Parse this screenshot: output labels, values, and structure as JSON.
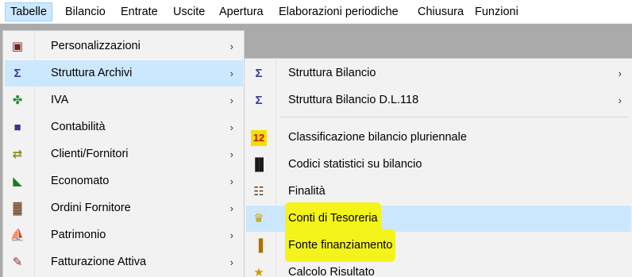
{
  "menubar": {
    "items": [
      "Tabelle",
      "Bilancio",
      "Entrate",
      "Uscite",
      "Apertura",
      "Elaborazioni periodiche",
      "Chiusura",
      "Funzioni"
    ]
  },
  "main_menu": {
    "items": [
      {
        "label": "Personalizzazioni",
        "icon": "personalizzazioni-icon",
        "glyph": "▣",
        "color": "#7a1f1f",
        "submenu": true
      },
      {
        "label": "Struttura Archivi",
        "icon": "struttura-archivi-icon",
        "glyph": "Σ",
        "color": "#3a3a9a",
        "submenu": true
      },
      {
        "label": "IVA",
        "icon": "iva-icon",
        "glyph": "✤",
        "color": "#2a8a3a",
        "submenu": true
      },
      {
        "label": "Contabilità",
        "icon": "contabilita-icon",
        "glyph": "■",
        "color": "#4a2a9a",
        "submenu": true
      },
      {
        "label": "Clienti/Fornitori",
        "icon": "clienti-fornitori-icon",
        "glyph": "⇄",
        "color": "#8a8a1a",
        "submenu": true
      },
      {
        "label": "Economato",
        "icon": "economato-icon",
        "glyph": "◣",
        "color": "#1a7a1a",
        "submenu": true
      },
      {
        "label": "Ordini Fornitore",
        "icon": "ordini-fornitore-icon",
        "glyph": "▓",
        "color": "#6a3a1a",
        "submenu": true
      },
      {
        "label": "Patrimonio",
        "icon": "patrimonio-icon",
        "glyph": "⛵",
        "color": "#333333",
        "submenu": true
      },
      {
        "label": "Fatturazione Attiva",
        "icon": "fatturazione-attiva-icon",
        "glyph": "✎",
        "color": "#8a2a2a",
        "submenu": true
      }
    ]
  },
  "sub_menu": {
    "items": [
      {
        "label": "Struttura Bilancio",
        "icon": "struttura-bilancio-icon",
        "glyph": "Σ",
        "color": "#3a3a9a",
        "submenu": true
      },
      {
        "label": "Struttura Bilancio D.L.118",
        "icon": "struttura-bilancio-dl118-icon",
        "glyph": "Σ",
        "color": "#3a3a9a",
        "submenu": true
      },
      {
        "label": "Classificazione bilancio pluriennale",
        "icon": "pluriennale-icon",
        "glyph": "12",
        "color": "#c01010",
        "submenu": false
      },
      {
        "label": "Codici statistici su bilancio",
        "icon": "codici-statistici-icon",
        "glyph": "▐▌",
        "color": "#1a1a1a",
        "submenu": false
      },
      {
        "label": "Finalità",
        "icon": "finalita-icon",
        "glyph": "☷",
        "color": "#5a3a1a",
        "submenu": false
      },
      {
        "label": "Conti di Tesoreria",
        "icon": "conti-tesoreria-icon",
        "glyph": "♛",
        "color": "#c8a000",
        "submenu": false
      },
      {
        "label": "Fonte finanziamento",
        "icon": "fonte-finanziamento-icon",
        "glyph": "▐",
        "color": "#b07000",
        "submenu": false
      },
      {
        "label": "Calcolo Risultato",
        "icon": "calcolo-risultato-icon",
        "glyph": "★",
        "color": "#c8a000",
        "submenu": false
      }
    ]
  },
  "colors": {
    "highlight_blue": "#cce8ff",
    "highlight_yellow": "#f4f41a"
  }
}
